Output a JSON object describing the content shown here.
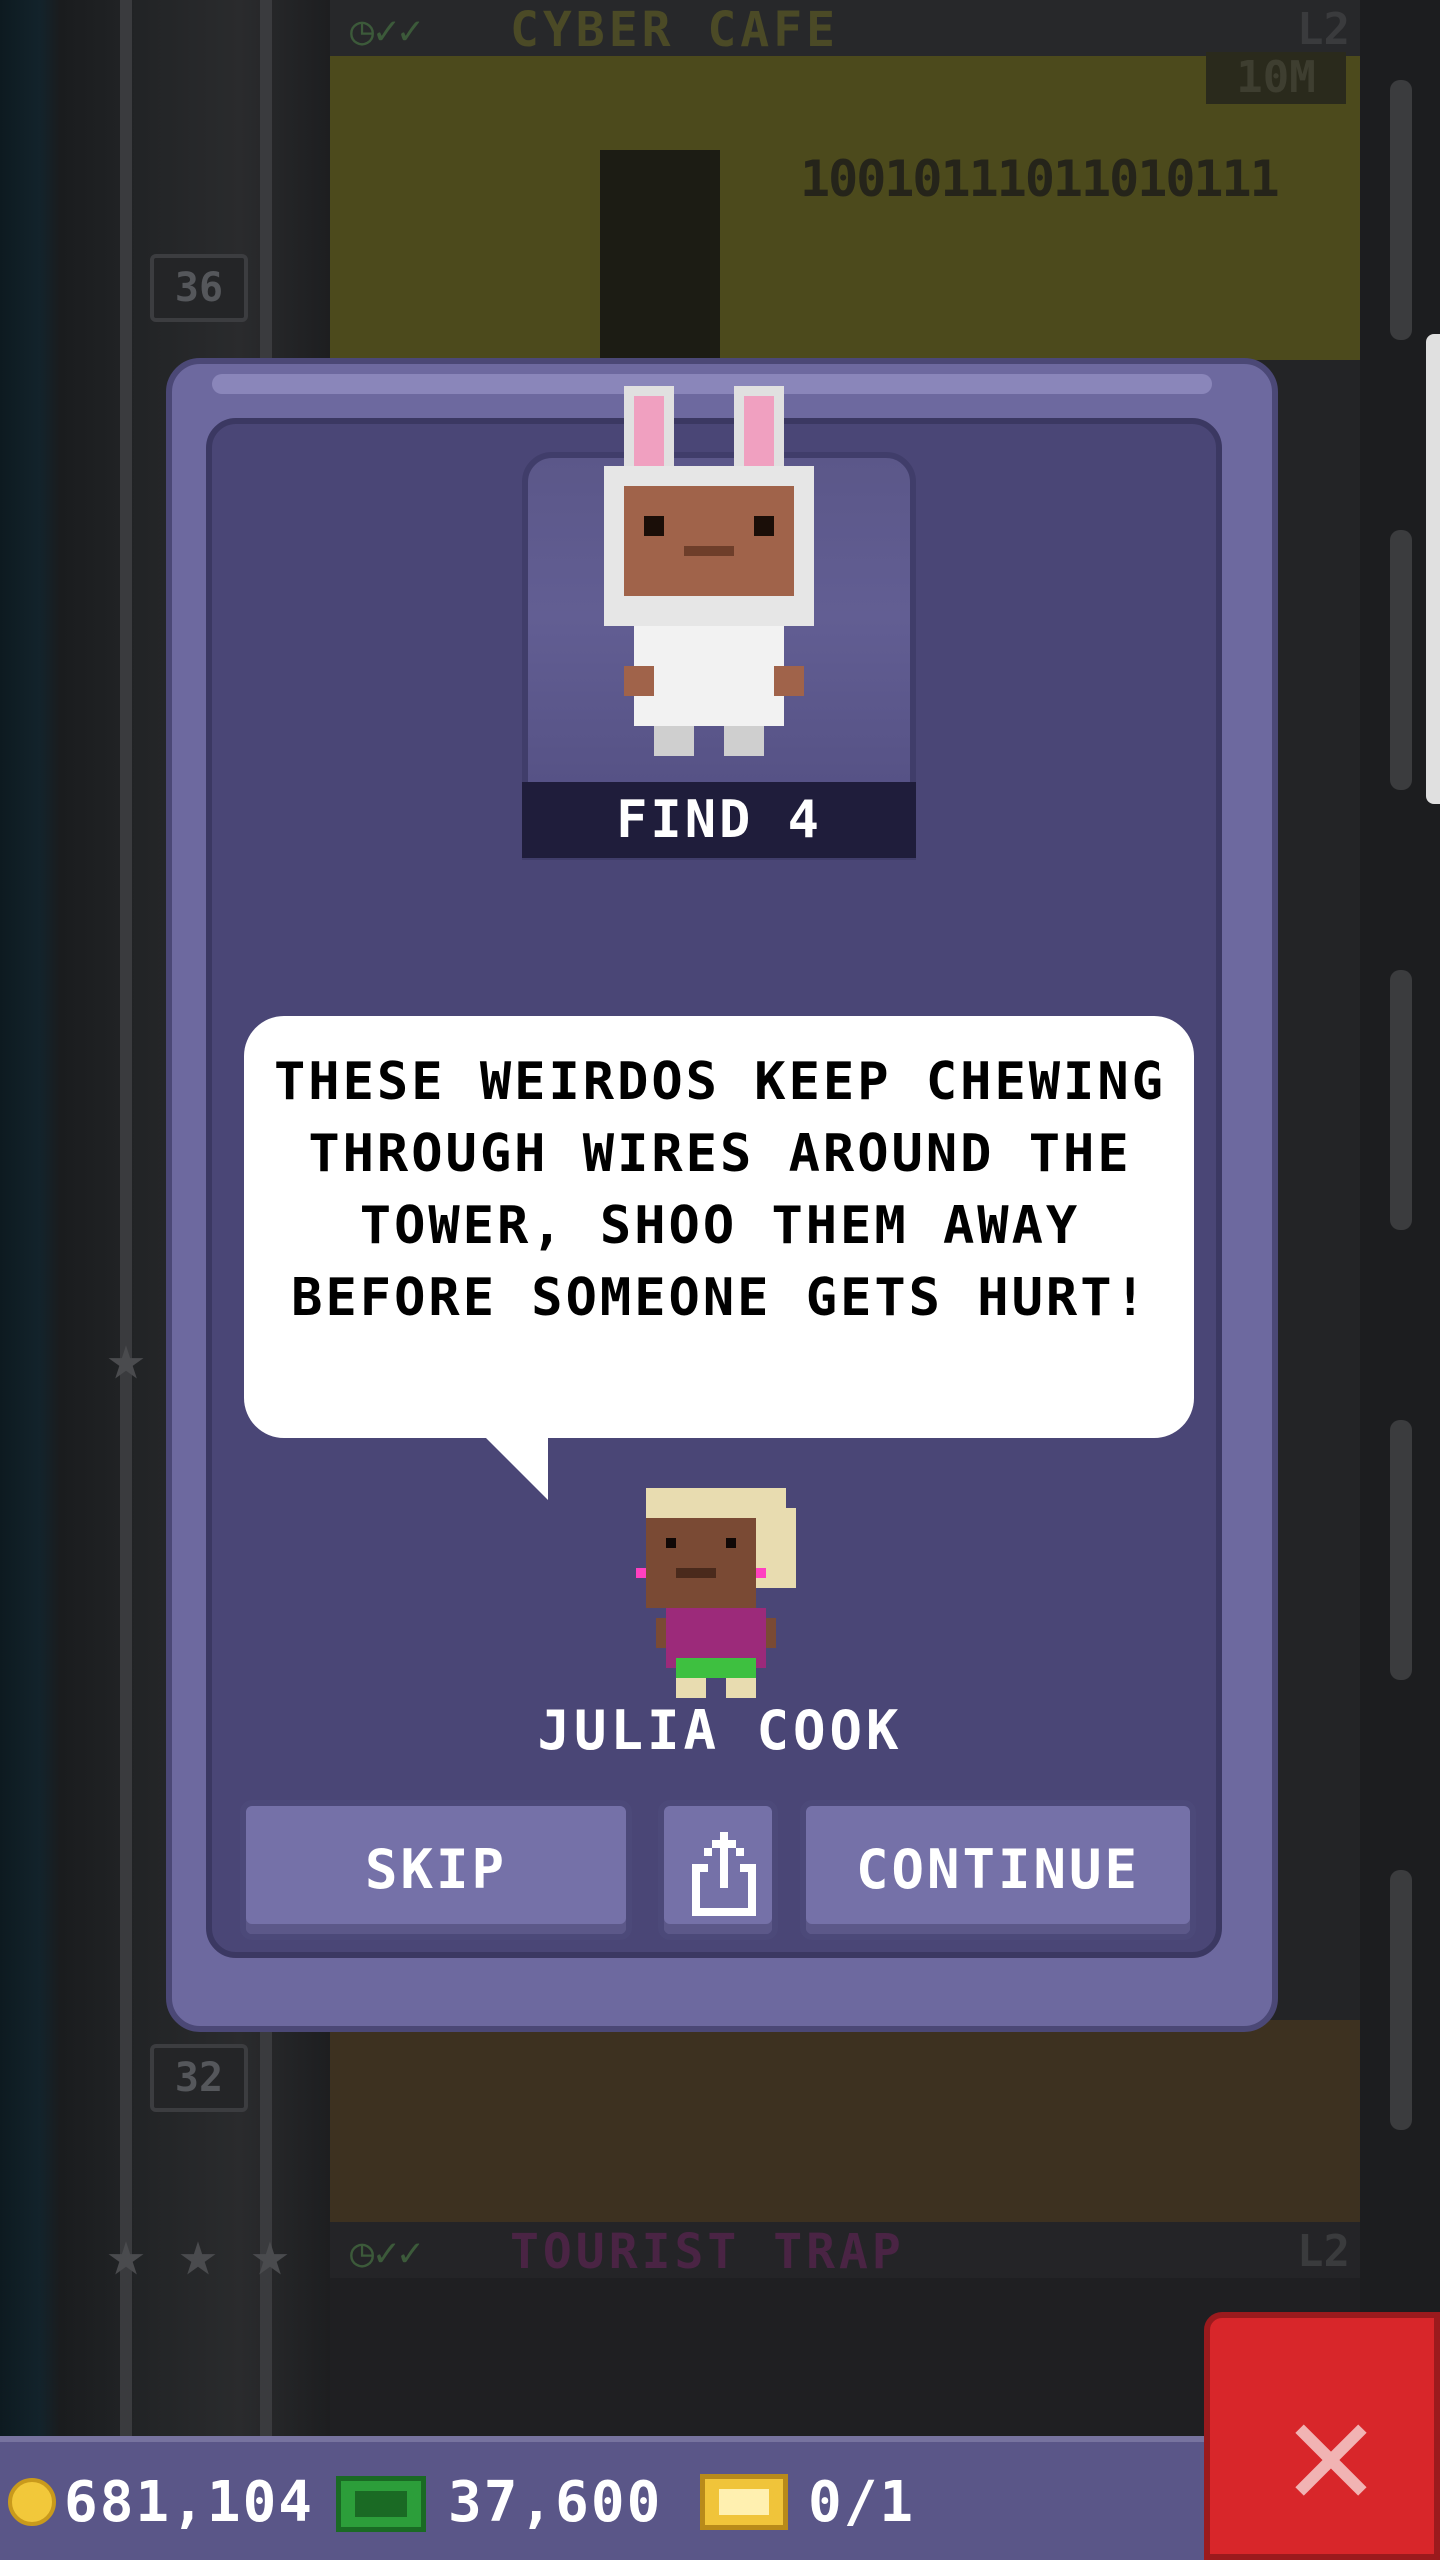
{
  "background": {
    "floors": [
      {
        "name": "CYBER CAFE",
        "level": "L2",
        "price": "10M"
      },
      {
        "name": "TOURIST TRAP",
        "level": "L2"
      }
    ],
    "floor_numbers": [
      "36",
      "32"
    ],
    "binary_sign": "10010111011010111"
  },
  "dialog": {
    "find_label": "FIND 4",
    "speech": "THESE WEIRDOS KEEP CHEWING THROUGH WIRES AROUND THE TOWER, SHOO THEM AWAY BEFORE SOMEONE GETS HURT!",
    "npc_name": "JULIA COOK",
    "buttons": {
      "skip": "SKIP",
      "continue": "CONTINUE"
    }
  },
  "statusbar": {
    "coins": "681,104",
    "cash": "37,600",
    "bux": "0/1"
  },
  "icons": [
    "coin-icon",
    "cash-icon",
    "bux-icon",
    "share-icon",
    "close-icon",
    "bunny-costume-bitizen",
    "npc-julia-cook"
  ],
  "colors": {
    "dialog_outer": "#6d699f",
    "dialog_inner": "#4a4676",
    "button": "#7571a8",
    "close_button": "#d8262a"
  }
}
